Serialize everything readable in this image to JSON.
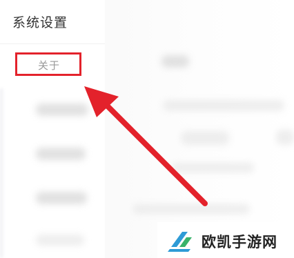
{
  "sidebar": {
    "title": "系统设置",
    "selected_item_label": "关于"
  },
  "annotation": {
    "highlight_color": "#e3222b",
    "arrow_color": "#e3222b",
    "icon": "arrow-icon"
  },
  "watermark": {
    "text": "欧凯手游网",
    "logo_icon": "logo-icon",
    "logo_color": "#2e9bd6"
  }
}
